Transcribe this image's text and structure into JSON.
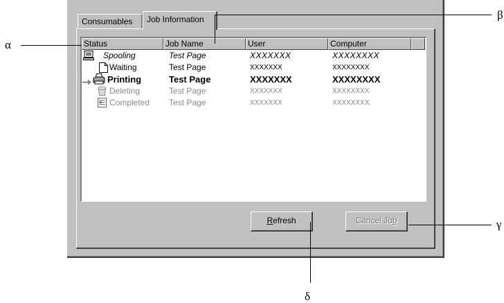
{
  "callouts": {
    "alpha": "α",
    "beta": "β",
    "gamma": "γ",
    "delta": "δ"
  },
  "tabs": [
    {
      "label": "Consumables",
      "active": false
    },
    {
      "label": "Job Information",
      "active": true
    }
  ],
  "columns": [
    "Status",
    "Job Name",
    "User",
    "Computer"
  ],
  "rows": [
    {
      "status": "Spooling",
      "job_name": "Test Page",
      "user": "XXXXXXX",
      "computer": "XXXXXXXX",
      "style": "italic",
      "icon": "computer-icon"
    },
    {
      "status": "Waiting",
      "job_name": "Test Page",
      "user": "XXXXXXX",
      "computer": "XXXXXXXX",
      "style": "normal",
      "icon": "document-icon"
    },
    {
      "status": "Printing",
      "job_name": "Test Page",
      "user": "XXXXXXX",
      "computer": "XXXXXXXX",
      "style": "bold",
      "icon": "printer-icon"
    },
    {
      "status": "Deleting",
      "job_name": "Test Page",
      "user": "XXXXXXX",
      "computer": "XXXXXXXX",
      "style": "gray",
      "icon": "trash-icon"
    },
    {
      "status": "Completed",
      "job_name": "Test Page",
      "user": "XXXXXXX",
      "computer": "XXXXXXXX",
      "style": "gray",
      "icon": "completed-document-icon"
    }
  ],
  "buttons": {
    "refresh": {
      "prefix": "",
      "accel": "R",
      "rest": "efresh"
    },
    "cancel_job": {
      "prefix": "Cancel Jo",
      "accel": "b",
      "rest": ""
    }
  },
  "colors": {
    "dialog_face": "#c0c0c0",
    "disabled_text": "#8a8a8a"
  }
}
